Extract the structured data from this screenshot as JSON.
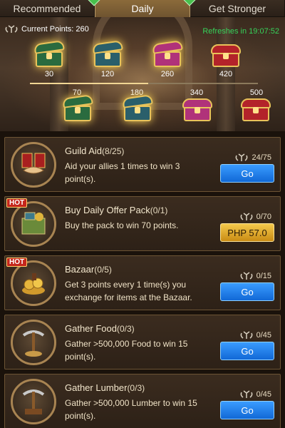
{
  "tabs": [
    {
      "label": "Recommended",
      "active": false,
      "badge": true
    },
    {
      "label": "Daily",
      "active": true,
      "badge": true
    },
    {
      "label": "Get Stronger",
      "active": false,
      "badge": false
    }
  ],
  "banner": {
    "points_label": "Current Points: 260",
    "refresh_label": "Refreshes in 19:07:52",
    "progress": 0.52,
    "chests": [
      {
        "value": "30",
        "color": "#2a6b3f",
        "opened": true
      },
      {
        "value": "120",
        "color": "#2a5f6b",
        "opened": true
      },
      {
        "value": "260",
        "color": "#b0327a",
        "opened": true
      },
      {
        "value": "420",
        "color": "#b3232a",
        "opened": false
      },
      {
        "value": "70",
        "color": "#2a6b3f",
        "opened": true
      },
      {
        "value": "180",
        "color": "#2a5f6b",
        "opened": true
      },
      {
        "value": "340",
        "color": "#b0327a",
        "opened": false
      },
      {
        "value": "500",
        "color": "#b3232a",
        "opened": false
      }
    ]
  },
  "tasks": [
    {
      "title": "Guild Aid",
      "count": "(8/25)",
      "desc": "Aid your allies 1 times to win 3 point(s).",
      "points": "24/75",
      "button": "Go",
      "button_type": "go",
      "hot": false,
      "icon": "handshake-icon"
    },
    {
      "title": "Buy Daily Offer Pack",
      "count": "(0/1)",
      "desc": "Buy the pack to win 70 points.",
      "points": "0/70",
      "button": "PHP 57.0",
      "button_type": "price",
      "hot": true,
      "hot_label": "HOT",
      "icon": "gift-pack-icon"
    },
    {
      "title": "Bazaar",
      "count": "(0/5)",
      "desc": "Get 3 points every 1 time(s) you exchange for items at the Bazaar.",
      "points": "0/15",
      "button": "Go",
      "button_type": "go",
      "hot": true,
      "hot_label": "HOT",
      "icon": "coin-pile-icon"
    },
    {
      "title": "Gather Food",
      "count": "(0/3)",
      "desc": "Gather >500,000 Food to win 15 point(s).",
      "points": "0/45",
      "button": "Go",
      "button_type": "go",
      "hot": false,
      "icon": "pickaxe-icon"
    },
    {
      "title": "Gather Lumber",
      "count": "(0/3)",
      "desc": "Gather >500,000 Lumber to win 15 point(s).",
      "points": "0/45",
      "button": "Go",
      "button_type": "go",
      "hot": false,
      "icon": "pickaxe-lumber-icon"
    }
  ]
}
